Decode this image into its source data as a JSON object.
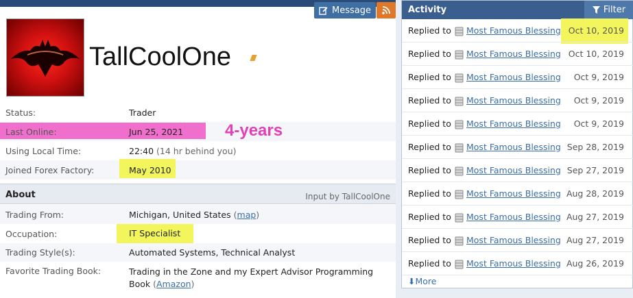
{
  "header": {
    "message_label": "Message"
  },
  "profile": {
    "username": "TallCoolOne"
  },
  "details": [
    {
      "label": "Status:",
      "value": "Trader"
    },
    {
      "label": "Last Online:",
      "value": "Jun 25, 2021"
    },
    {
      "label": "Using Local Time:",
      "value": "22:40",
      "note": "(14 hr behind you)"
    },
    {
      "label": "Joined Forex Factory:",
      "value": "May 2010"
    }
  ],
  "annotation": {
    "years": "4-years"
  },
  "about": {
    "title": "About",
    "input_by": "Input by TallCoolOne",
    "rows": [
      {
        "label": "Trading From:",
        "value": "Michigan, United States",
        "link": "map"
      },
      {
        "label": "Occupation:",
        "value": "IT Specialist"
      },
      {
        "label": "Trading Style(s):",
        "value": "Automated Systems, Technical Analyst"
      },
      {
        "label": "Favorite Trading Book:",
        "value_line1": "Trading in the Zone and my Expert Advisor Programming",
        "value_line2": "Book",
        "link": "Amazon"
      }
    ]
  },
  "activity": {
    "title": "Activity",
    "filter_label": "Filter",
    "more_label": "More",
    "items": [
      {
        "action": "Replied to",
        "topic": "Most Famous Blessing",
        "date": "Oct 10, 2019"
      },
      {
        "action": "Replied to",
        "topic": "Most Famous Blessing",
        "date": "Oct 10, 2019"
      },
      {
        "action": "Replied to",
        "topic": "Most Famous Blessing",
        "date": "Oct 9, 2019"
      },
      {
        "action": "Replied to",
        "topic": "Most Famous Blessing",
        "date": "Oct 9, 2019"
      },
      {
        "action": "Replied to",
        "topic": "Most Famous Blessing",
        "date": "Oct 9, 2019"
      },
      {
        "action": "Replied to",
        "topic": "Most Famous Blessing",
        "date": "Sep 28, 2019"
      },
      {
        "action": "Replied to",
        "topic": "Most Famous Blessing",
        "date": "Sep 27, 2019"
      },
      {
        "action": "Replied to",
        "topic": "Most Famous Blessing",
        "date": "Aug 28, 2019"
      },
      {
        "action": "Replied to",
        "topic": "Most Famous Blessing",
        "date": "Aug 27, 2019"
      },
      {
        "action": "Replied to",
        "topic": "Most Famous Blessing",
        "date": "Aug 27, 2019"
      },
      {
        "action": "Replied to",
        "topic": "Most Famous Blessing",
        "date": "Aug 26, 2019"
      }
    ]
  },
  "colors": {
    "header": "#3a5f8f",
    "link": "#3a6ea8",
    "highlight_yellow": "#f2f55c",
    "highlight_pink": "#f06fcd",
    "rss": "#e0782a"
  }
}
